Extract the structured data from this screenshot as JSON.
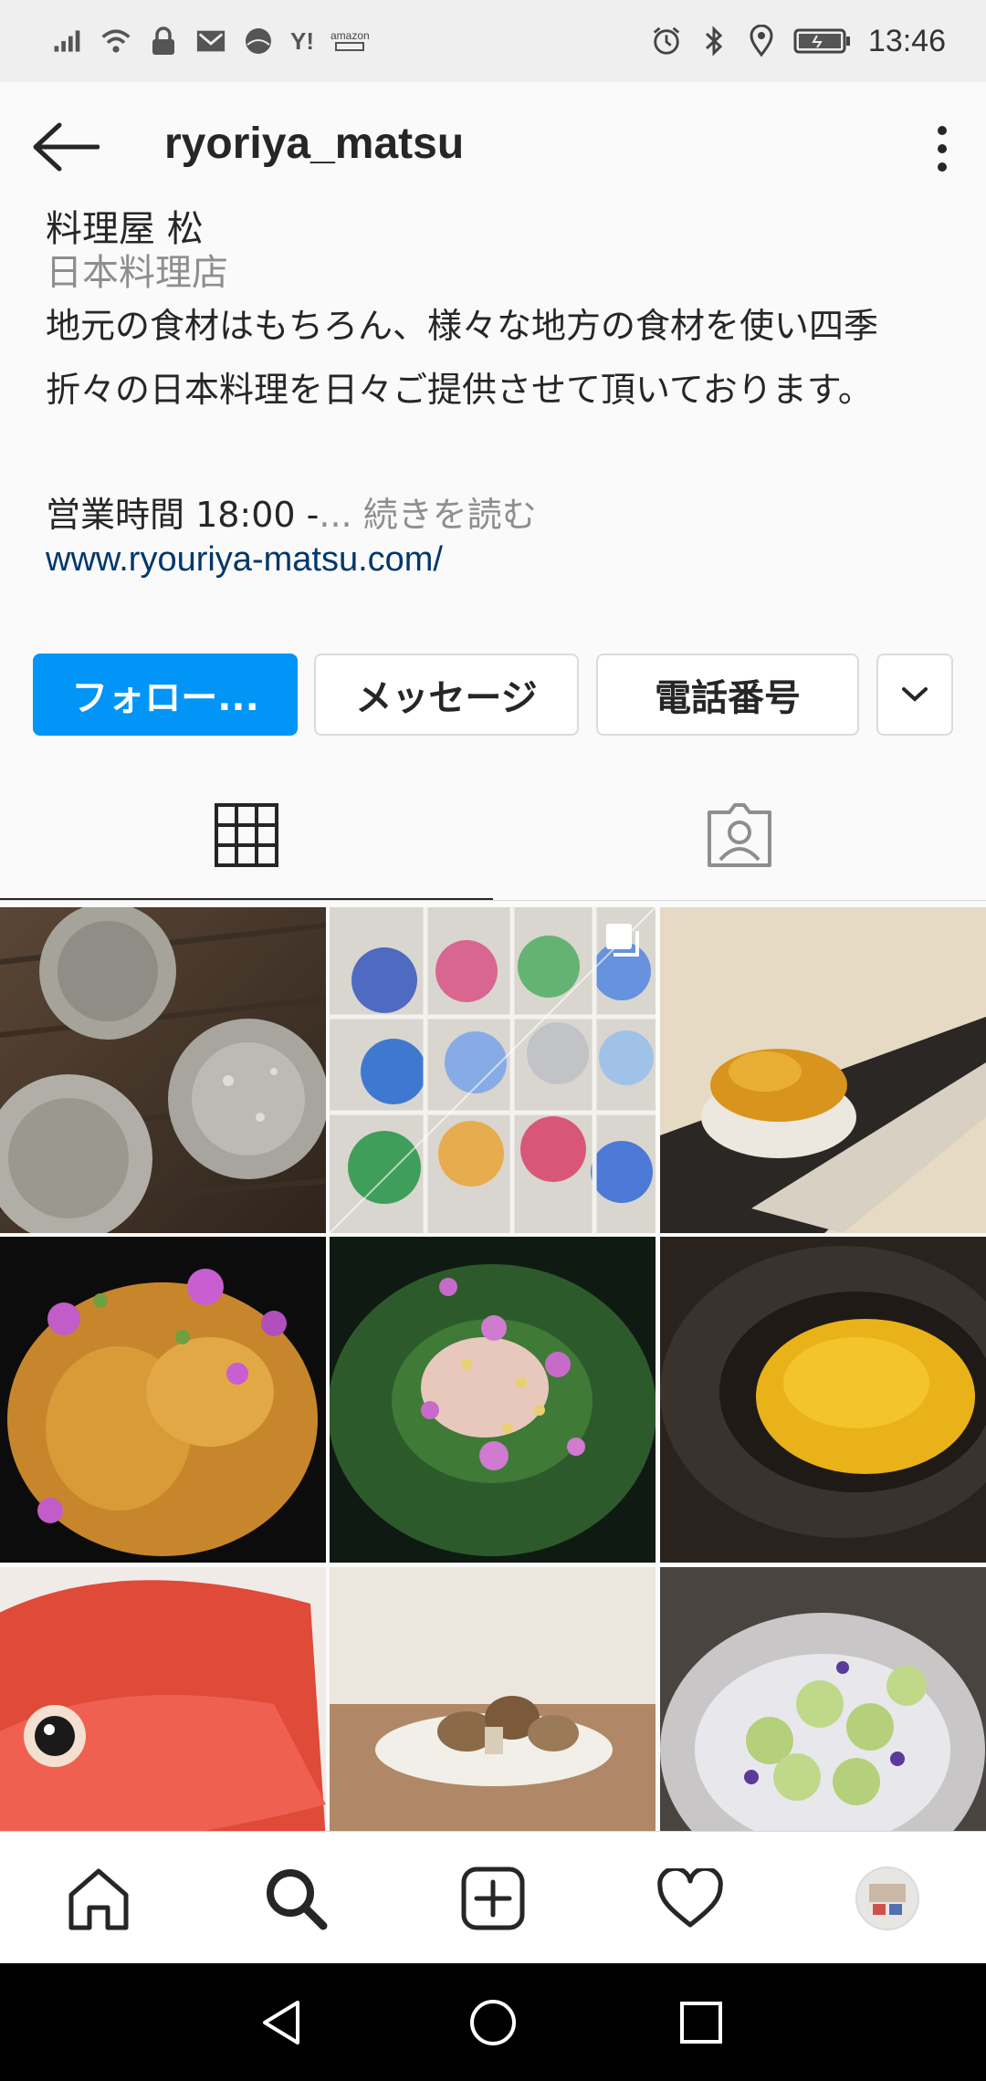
{
  "status_bar": {
    "time": "13:46",
    "left_icons": [
      "signal-icon",
      "wifi-icon",
      "lock-icon",
      "mail-icon",
      "ball-icon",
      "yahoo-icon",
      "amazon-icon"
    ],
    "yahoo_text": "Y!",
    "amazon_text": "amazon",
    "right_icons": [
      "alarm-icon",
      "bluetooth-icon",
      "location-icon",
      "battery-icon"
    ]
  },
  "header": {
    "username": "ryoriya_matsu"
  },
  "bio": {
    "name": "料理屋 松",
    "category": "日本料理店",
    "description": "地元の食材はもちろん、様々な地方の食材を使い四季折々の日本料理を日々ご提供させて頂いております。",
    "hours": "営業時間 18:00 -",
    "read_more": "... 続きを読む",
    "link": "www.ryouriya-matsu.com/"
  },
  "buttons": {
    "follow": "フォロー...",
    "message": "メッセージ",
    "phone": "電話番号"
  },
  "tabs": [
    "grid-icon",
    "tagged-icon"
  ],
  "bottom_nav": [
    "home-icon",
    "search-icon",
    "add-post-icon",
    "heart-icon",
    "profile-avatar"
  ],
  "colors": {
    "accent": "#0095f6",
    "link": "#00376b",
    "secondary_text": "#8e8e8e"
  }
}
